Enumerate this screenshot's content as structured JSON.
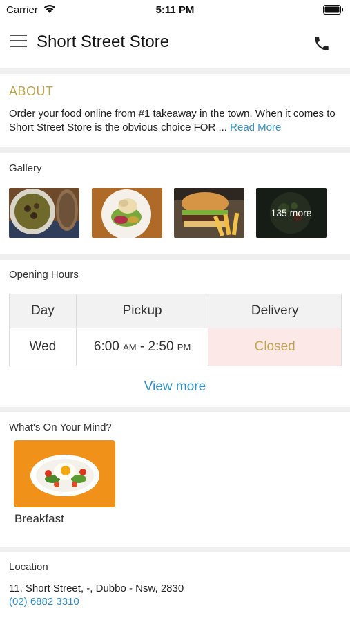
{
  "status_bar": {
    "carrier": "Carrier",
    "time": "5:11 PM"
  },
  "app_bar": {
    "title": "Short Street Store"
  },
  "about": {
    "title": "ABOUT",
    "text": "Order your food online from #1 takeaway in the town. When it comes to Short Street Store is the obvious choice FOR  ...",
    "read_more": "Read More"
  },
  "gallery": {
    "title": "Gallery",
    "more_label": "135 more"
  },
  "opening_hours": {
    "title": "Opening Hours",
    "columns": [
      "Day",
      "Pickup",
      "Delivery"
    ],
    "rows": [
      {
        "day": "Wed",
        "pickup_start": "6:00",
        "pickup_start_ampm": "AM",
        "pickup_sep": " - ",
        "pickup_end": "2:50",
        "pickup_end_ampm": "PM",
        "delivery": "Closed"
      }
    ],
    "view_more": "View more"
  },
  "whats_on_your_mind": {
    "title": "What's On Your Mind?",
    "categories": [
      {
        "label": "Breakfast"
      }
    ]
  },
  "location": {
    "title": "Location",
    "address": "11, Short Street, -, Dubbo - Nsw, 2830",
    "phone": "(02) 6882 3310"
  },
  "colors": {
    "accent_gold": "#c2a44c",
    "link_blue": "#2f8fc7",
    "closed_bg": "#fde8e8",
    "category_orange": "#f0921a"
  },
  "icons": [
    "wifi-icon",
    "battery-icon",
    "menu-icon",
    "phone-icon"
  ]
}
